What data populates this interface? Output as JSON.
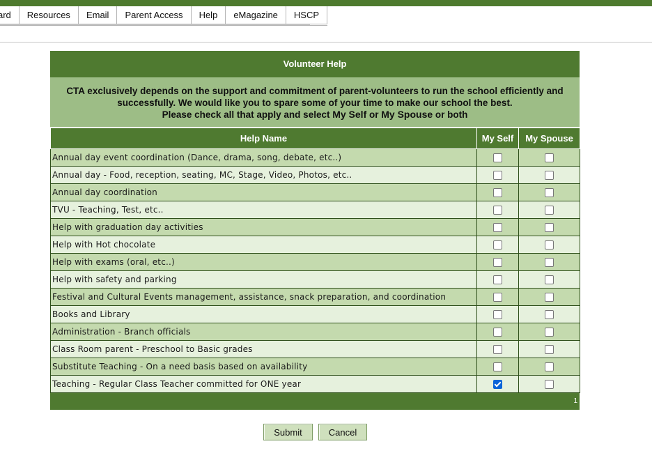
{
  "nav": {
    "tabs": [
      "ard",
      "Resources",
      "Email",
      "Parent Access",
      "Help",
      "eMagazine",
      "HSCP"
    ]
  },
  "panel": {
    "title": "Volunteer Help",
    "desc_line1": "CTA exclusively depends on the support and commitment of parent-volunteers to run the school efficiently and successfully. We would like you to spare some of your time to make our school the best.",
    "desc_prefix": "Please check all that apply and select ",
    "desc_myself": "My Self",
    "desc_or": " or ",
    "desc_myspouse": "My Spouse",
    "desc_suffix": " or both"
  },
  "table": {
    "headers": [
      "Help Name",
      "My Self",
      "My Spouse"
    ],
    "rows": [
      {
        "name": "Annual day event coordination (Dance, drama, song, debate, etc..)",
        "myself": false,
        "spouse": false
      },
      {
        "name": "Annual day - Food, reception, seating, MC, Stage, Video, Photos, etc..",
        "myself": false,
        "spouse": false
      },
      {
        "name": "Annual day coordination",
        "myself": false,
        "spouse": false
      },
      {
        "name": "TVU - Teaching, Test, etc..",
        "myself": false,
        "spouse": false
      },
      {
        "name": "Help with graduation day activities",
        "myself": false,
        "spouse": false
      },
      {
        "name": "Help with Hot chocolate",
        "myself": false,
        "spouse": false
      },
      {
        "name": "Help with exams (oral, etc..)",
        "myself": false,
        "spouse": false
      },
      {
        "name": "Help with safety and parking",
        "myself": false,
        "spouse": false
      },
      {
        "name": "Festival and Cultural Events management, assistance, snack preparation, and coordination",
        "myself": false,
        "spouse": false
      },
      {
        "name": "Books and Library",
        "myself": false,
        "spouse": false
      },
      {
        "name": "Administration - Branch officials",
        "myself": false,
        "spouse": false
      },
      {
        "name": "Class Room parent - Preschool to Basic grades",
        "myself": false,
        "spouse": false
      },
      {
        "name": "Substitute Teaching - On a need basis based on availability",
        "myself": false,
        "spouse": false
      },
      {
        "name": "Teaching - Regular Class Teacher committed for ONE year",
        "myself": true,
        "spouse": false
      }
    ],
    "page_number": "1"
  },
  "buttons": {
    "submit": "Submit",
    "cancel": "Cancel"
  },
  "colors": {
    "brand_green": "#4f7a30",
    "row_dark": "#c4daae",
    "row_light": "#e6f1dd",
    "checkbox_checked": "#0a64d8"
  }
}
